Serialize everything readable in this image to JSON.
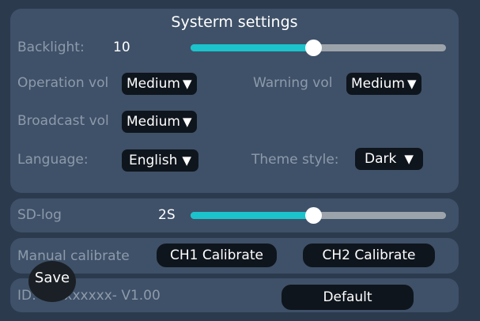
{
  "title": "Systerm settings",
  "backlight": {
    "label": "Backlight:",
    "value": "10",
    "level": 0.48
  },
  "operation_vol": {
    "label": "Operation vol",
    "value": "Medium"
  },
  "warning_vol": {
    "label": "Warning vol",
    "value": "Medium"
  },
  "broadcast_vol": {
    "label": "Broadcast vol",
    "value": "Medium"
  },
  "language": {
    "label": "Language:",
    "value": "English"
  },
  "theme_style": {
    "label": "Theme style:",
    "value": "Dark"
  },
  "sd_log": {
    "label": "SD-log",
    "value": "2S",
    "level": 0.48
  },
  "calibrate": {
    "label": "Manual calibrate",
    "ch1": "CH1 Calibrate",
    "ch2": "CH2 Calibrate"
  },
  "version": {
    "label": "ID: xxxxxxxxx- V1.00",
    "default_button": "Default"
  },
  "save_button": "Save",
  "arrow_glyph": "▼",
  "colors": {
    "background": "#2b3a4d",
    "panel": "#3f5168",
    "accent": "#1bc3cc",
    "control": "#0f151d"
  }
}
